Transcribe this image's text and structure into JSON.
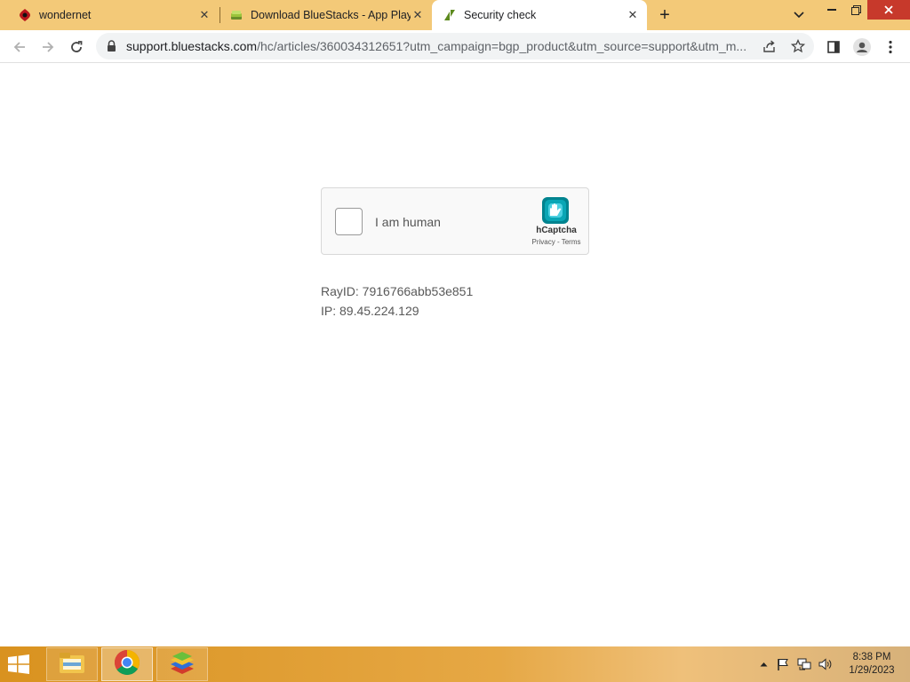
{
  "browser": {
    "tabs": [
      {
        "title": "wondernet",
        "favicon": "wondernet-icon",
        "active": false
      },
      {
        "title": "Download BlueStacks - App Playe",
        "favicon": "bluestacks-icon",
        "active": false
      },
      {
        "title": "Security check",
        "favicon": "zendesk-icon",
        "active": true
      }
    ],
    "url_host": "support.bluestacks.com",
    "url_path": "/hc/articles/360034312651?utm_campaign=bgp_product&utm_source=support&utm_m...",
    "accent_color": "#f3c978"
  },
  "captcha": {
    "checkbox_label": "I am human",
    "brand": "hCaptcha",
    "privacy_label": "Privacy",
    "link_separator": " - ",
    "terms_label": "Terms"
  },
  "info": {
    "ray_id": "RayID: 7916766abb53e851",
    "ip": "IP: 89.45.224.129"
  },
  "taskbar": {
    "apps": [
      "file-explorer-icon",
      "chrome-icon",
      "bluestacks-icon"
    ],
    "time": "8:38 PM",
    "date": "1/29/2023"
  }
}
